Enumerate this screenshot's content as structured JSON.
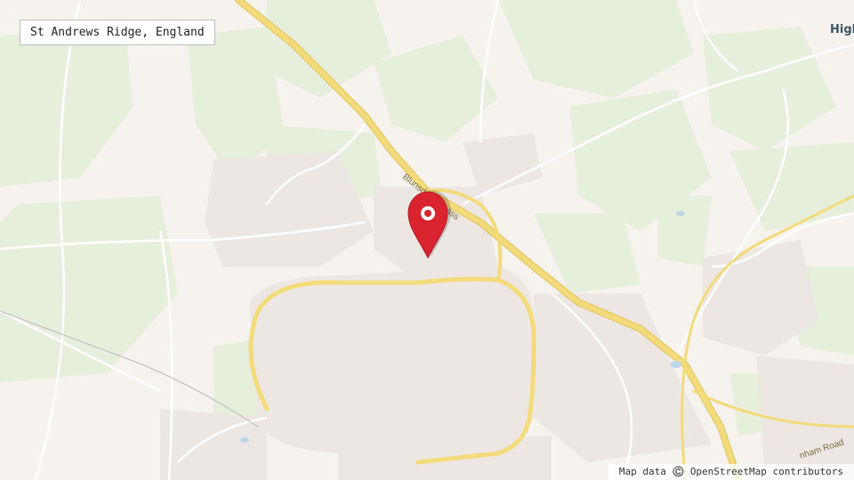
{
  "location": {
    "name": "St Andrews Ridge, England"
  },
  "attribution": {
    "text": "Map data ©️ OpenStreetMap contributors"
  },
  "map": {
    "town_labels": [
      "High"
    ],
    "road_labels": [
      "Blunsdon Bypass",
      "nham Road"
    ],
    "colors": {
      "land": "#f6f3ee",
      "woodland": "#e6eedc",
      "urban": "#ece7e2",
      "major_road": "#f3da7a",
      "minor_road": "#ffffff",
      "marker": "#d9232e"
    },
    "marker_icon": "map-pin-icon"
  }
}
